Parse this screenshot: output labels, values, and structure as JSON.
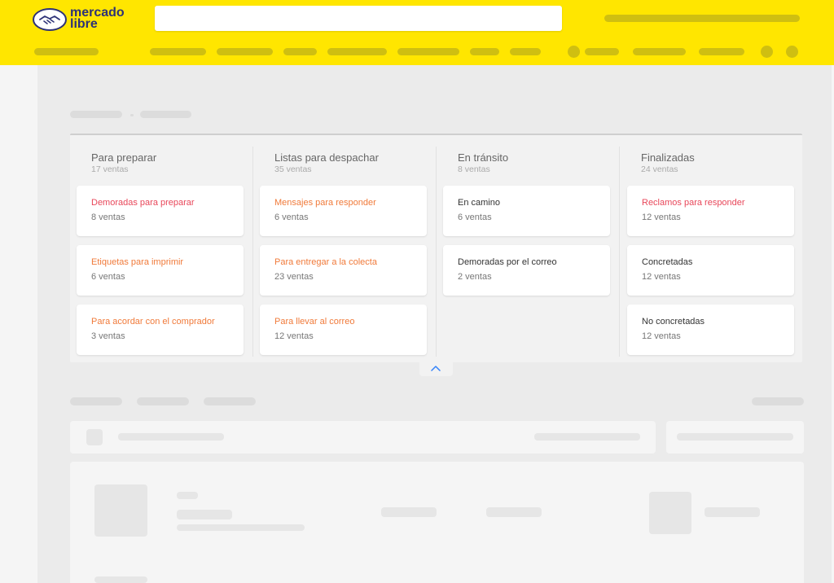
{
  "brand": {
    "line1": "mercado",
    "line2": "libre",
    "icon": "handshake-icon",
    "color": "#2d3277"
  },
  "colors": {
    "header": "#ffe600",
    "alert": "#e8475a",
    "warning": "#f07a3a"
  },
  "columns": [
    {
      "title": "Para preparar",
      "count": "17 ventas",
      "cards": [
        {
          "title": "Demoradas para preparar",
          "count": "8 ventas",
          "tone": "red"
        },
        {
          "title": "Etiquetas para imprimir",
          "count": "6 ventas",
          "tone": "orange"
        },
        {
          "title": "Para acordar con el comprador",
          "count": "3 ventas",
          "tone": "orange"
        }
      ]
    },
    {
      "title": "Listas para despachar",
      "count": "35 ventas",
      "cards": [
        {
          "title": "Mensajes para responder",
          "count": "6 ventas",
          "tone": "orange"
        },
        {
          "title": "Para entregar a la colecta",
          "count": "23 ventas",
          "tone": "orange"
        },
        {
          "title": "Para llevar al correo",
          "count": "12 ventas",
          "tone": "orange"
        }
      ]
    },
    {
      "title": "En tránsito",
      "count": "8 ventas",
      "cards": [
        {
          "title": "En camino",
          "count": "6 ventas",
          "tone": "default"
        },
        {
          "title": "Demoradas por el correo",
          "count": "2 ventas",
          "tone": "default"
        }
      ]
    },
    {
      "title": "Finalizadas",
      "count": "24 ventas",
      "cards": [
        {
          "title": "Reclamos para responder",
          "count": "12 ventas",
          "tone": "red"
        },
        {
          "title": "Concretadas",
          "count": "12 ventas",
          "tone": "default"
        },
        {
          "title": "No concretadas",
          "count": "12 ventas",
          "tone": "default"
        }
      ]
    }
  ],
  "collapse_icon": "chevron-up-icon"
}
